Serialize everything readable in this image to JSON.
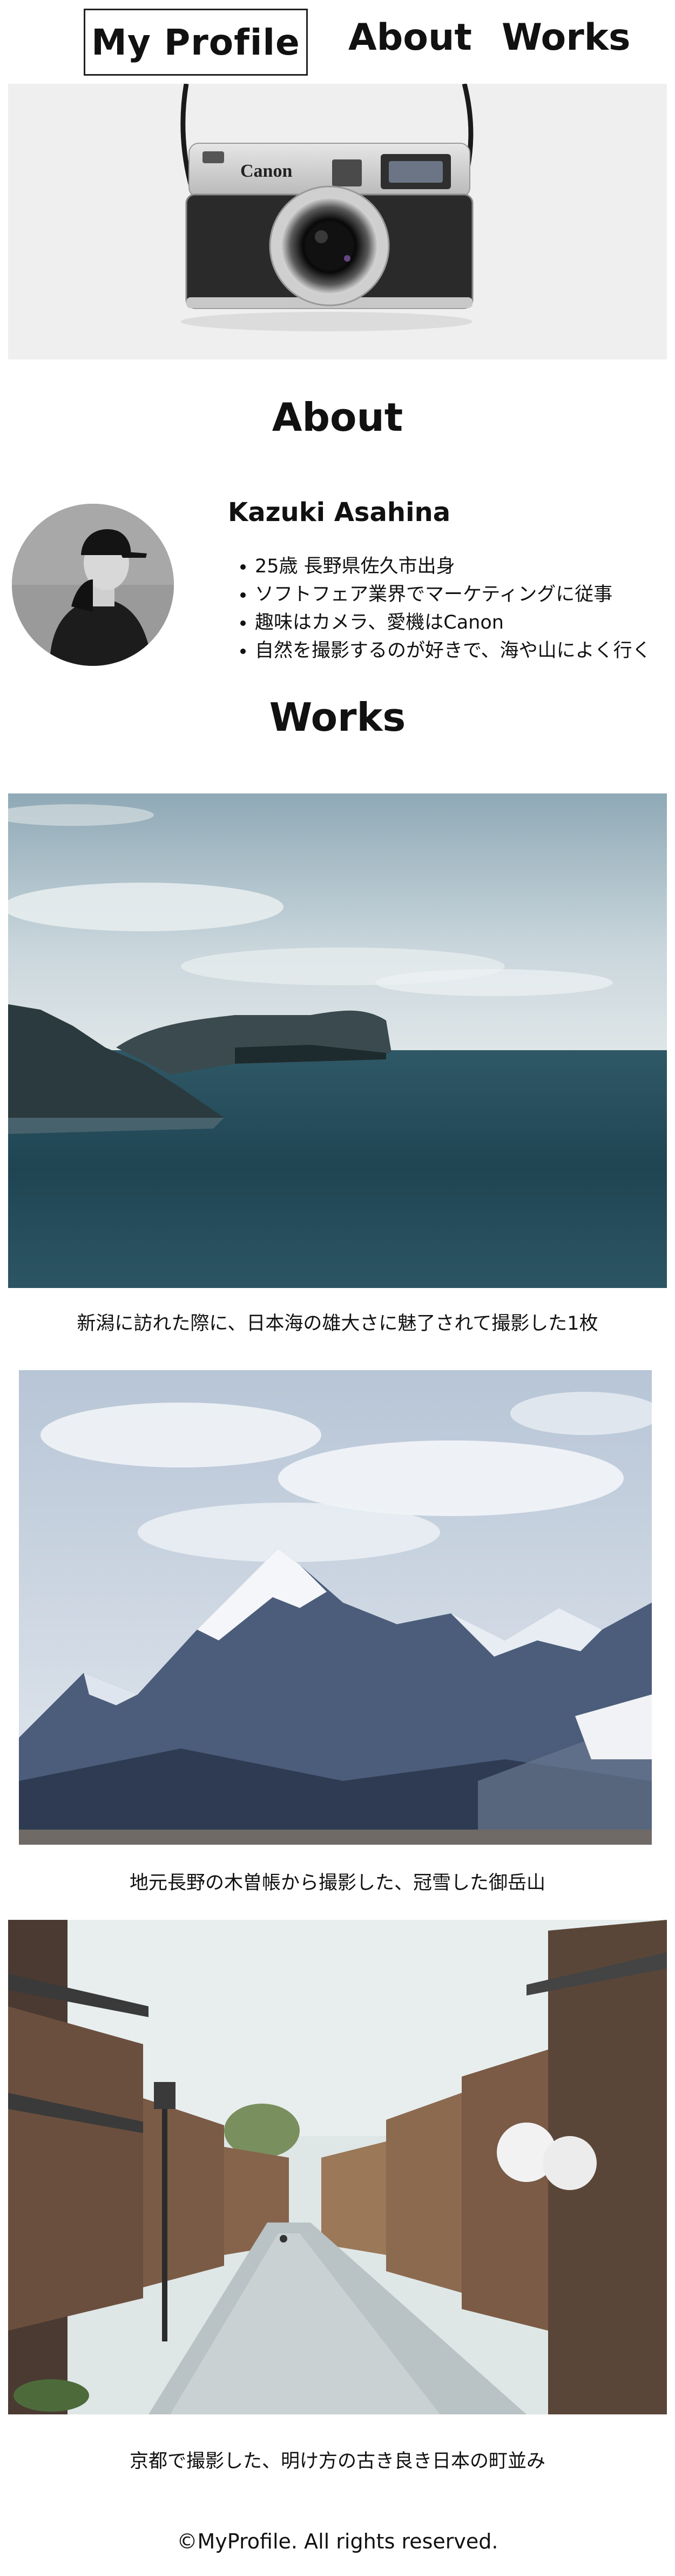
{
  "header": {
    "logo": "My Profile",
    "nav": [
      "About",
      "Works"
    ]
  },
  "hero": {
    "image_alt": "camera-photo",
    "camera_brand": "Canon"
  },
  "about": {
    "title": "About",
    "name": "Kazuki Asahina",
    "details": [
      "25歳 長野県佐久市出身",
      "ソフトフェア業界でマーケティングに従事",
      "趣味はカメラ、愛機はCanon",
      "自然を撮影するのが好きで、海や山によく行く"
    ]
  },
  "works": {
    "title": "Works",
    "items": [
      {
        "image": "sea-cliff-photo",
        "caption": "新潟に訪れた際に、日本海の雄大さに魅了されて撮影した1枚"
      },
      {
        "image": "snow-mountain-photo",
        "caption": "地元長野の木曽帳から撮影した、冠雪した御岳山"
      },
      {
        "image": "kyoto-street-photo",
        "caption": "京都で撮影した、明け方の古き良き日本の町並み"
      }
    ]
  },
  "footer": {
    "text": "©MyProfile. All rights reserved."
  }
}
